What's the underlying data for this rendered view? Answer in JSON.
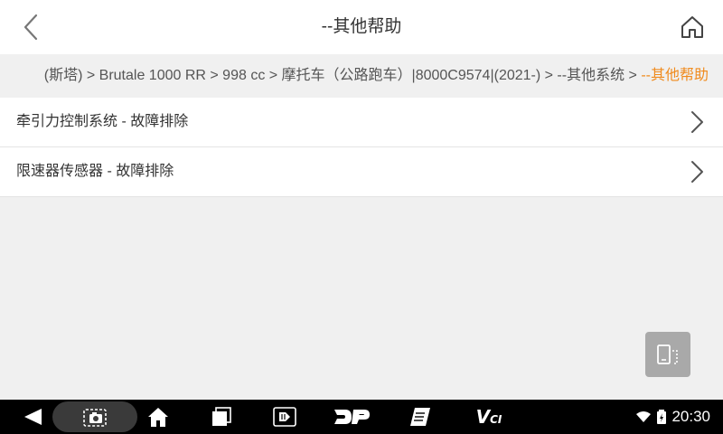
{
  "header": {
    "title": "--其他帮助",
    "back_icon": "chevron-left-icon",
    "home_icon": "home-icon"
  },
  "breadcrumb": {
    "trail": "(斯塔) > Brutale 1000 RR > 998 cc > 摩托车（公路跑车）|8000C9574|(2021-) > --其他系统 > ",
    "current": "--其他帮助"
  },
  "items": [
    {
      "label": "牵引力控制系统 - 故障排除"
    },
    {
      "label": "限速器传感器 - 故障排除"
    }
  ],
  "floating_button": {
    "icon": "switch-device-icon"
  },
  "navbar": {
    "items": [
      "back-triangle-icon",
      "screenshot-icon",
      "home-icon",
      "recent-apps-icon",
      "vehicle-scan-icon",
      "dp-icon",
      "manual-icon",
      "vci-icon"
    ],
    "vci_label": "V",
    "vci_sub": "CI"
  },
  "status": {
    "time": "20:30",
    "wifi_icon": "wifi-icon",
    "battery_icon": "battery-charging-icon"
  },
  "colors": {
    "accent": "#f08a1c",
    "background": "#f0f0f0",
    "navbar": "#000000"
  }
}
